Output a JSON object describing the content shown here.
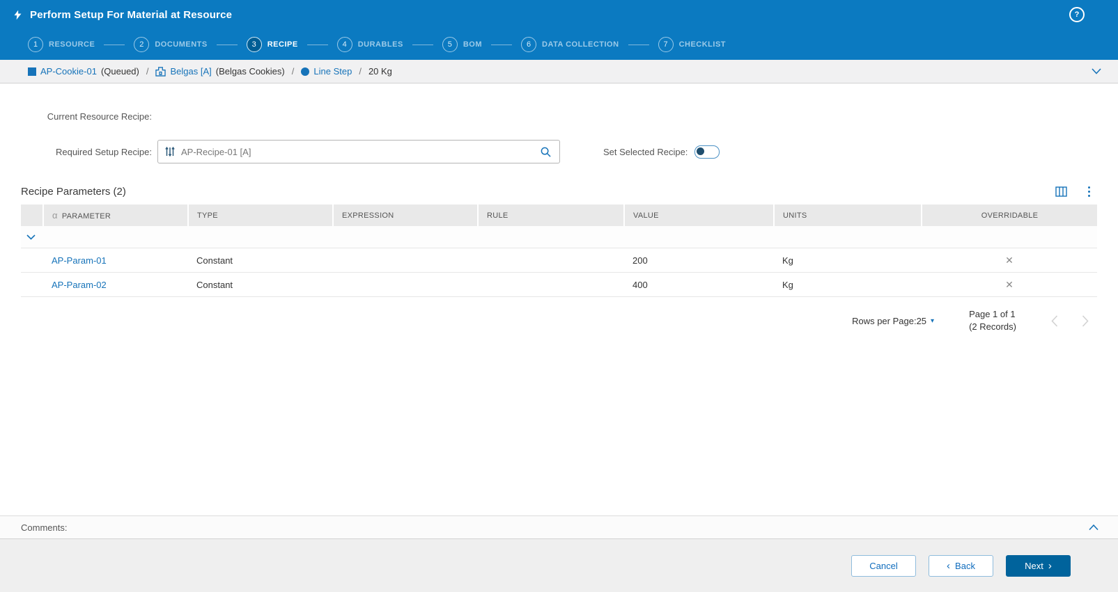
{
  "colors": {
    "brand_blue": "#0b7ac1",
    "active_step_blue": "#005e95",
    "link_blue": "#1673b9",
    "primary_button_blue": "#00639c"
  },
  "icons": {
    "help": "?",
    "alpha": "α",
    "overridable_no": "✕",
    "rows_per_page_caret": "▾",
    "back_chevron": "‹",
    "next_chevron": "›"
  },
  "header": {
    "title": "Perform Setup For Material at Resource"
  },
  "stepper": {
    "steps": [
      {
        "num": "1",
        "label": "RESOURCE"
      },
      {
        "num": "2",
        "label": "DOCUMENTS"
      },
      {
        "num": "3",
        "label": "RECIPE"
      },
      {
        "num": "4",
        "label": "DURABLES"
      },
      {
        "num": "5",
        "label": "BOM"
      },
      {
        "num": "6",
        "label": "DATA COLLECTION"
      },
      {
        "num": "7",
        "label": "CHECKLIST"
      }
    ]
  },
  "breadcrumb": {
    "material": "AP-Cookie-01",
    "material_status": "(Queued)",
    "resource": "Belgas [A]",
    "resource_desc": "(Belgas Cookies)",
    "step": "Line Step",
    "quantity": "20 Kg",
    "separator": "/"
  },
  "form": {
    "current_recipe_label": "Current Resource Recipe:",
    "required_recipe_label": "Required Setup Recipe:",
    "required_recipe_value": "AP-Recipe-01 [A]",
    "set_selected_label": "Set Selected Recipe:"
  },
  "parameters": {
    "title": "Recipe Parameters (2)",
    "columns": [
      "PARAMETER",
      "TYPE",
      "EXPRESSION",
      "RULE",
      "VALUE",
      "UNITS",
      "OVERRIDABLE"
    ],
    "rows": [
      {
        "parameter": "AP-Param-01",
        "type": "Constant",
        "expression": "",
        "rule": "",
        "value": "200",
        "units": "Kg"
      },
      {
        "parameter": "AP-Param-02",
        "type": "Constant",
        "expression": "",
        "rule": "",
        "value": "400",
        "units": "Kg"
      }
    ],
    "pagination": {
      "rows_per_page_label": "Rows per Page:",
      "rows_per_page_value": "25",
      "page_info": "Page 1 of 1",
      "records_info": "(2 Records)"
    }
  },
  "comments": {
    "label": "Comments:"
  },
  "footer": {
    "cancel_label": "Cancel",
    "back_label": "Back",
    "next_label": "Next"
  }
}
